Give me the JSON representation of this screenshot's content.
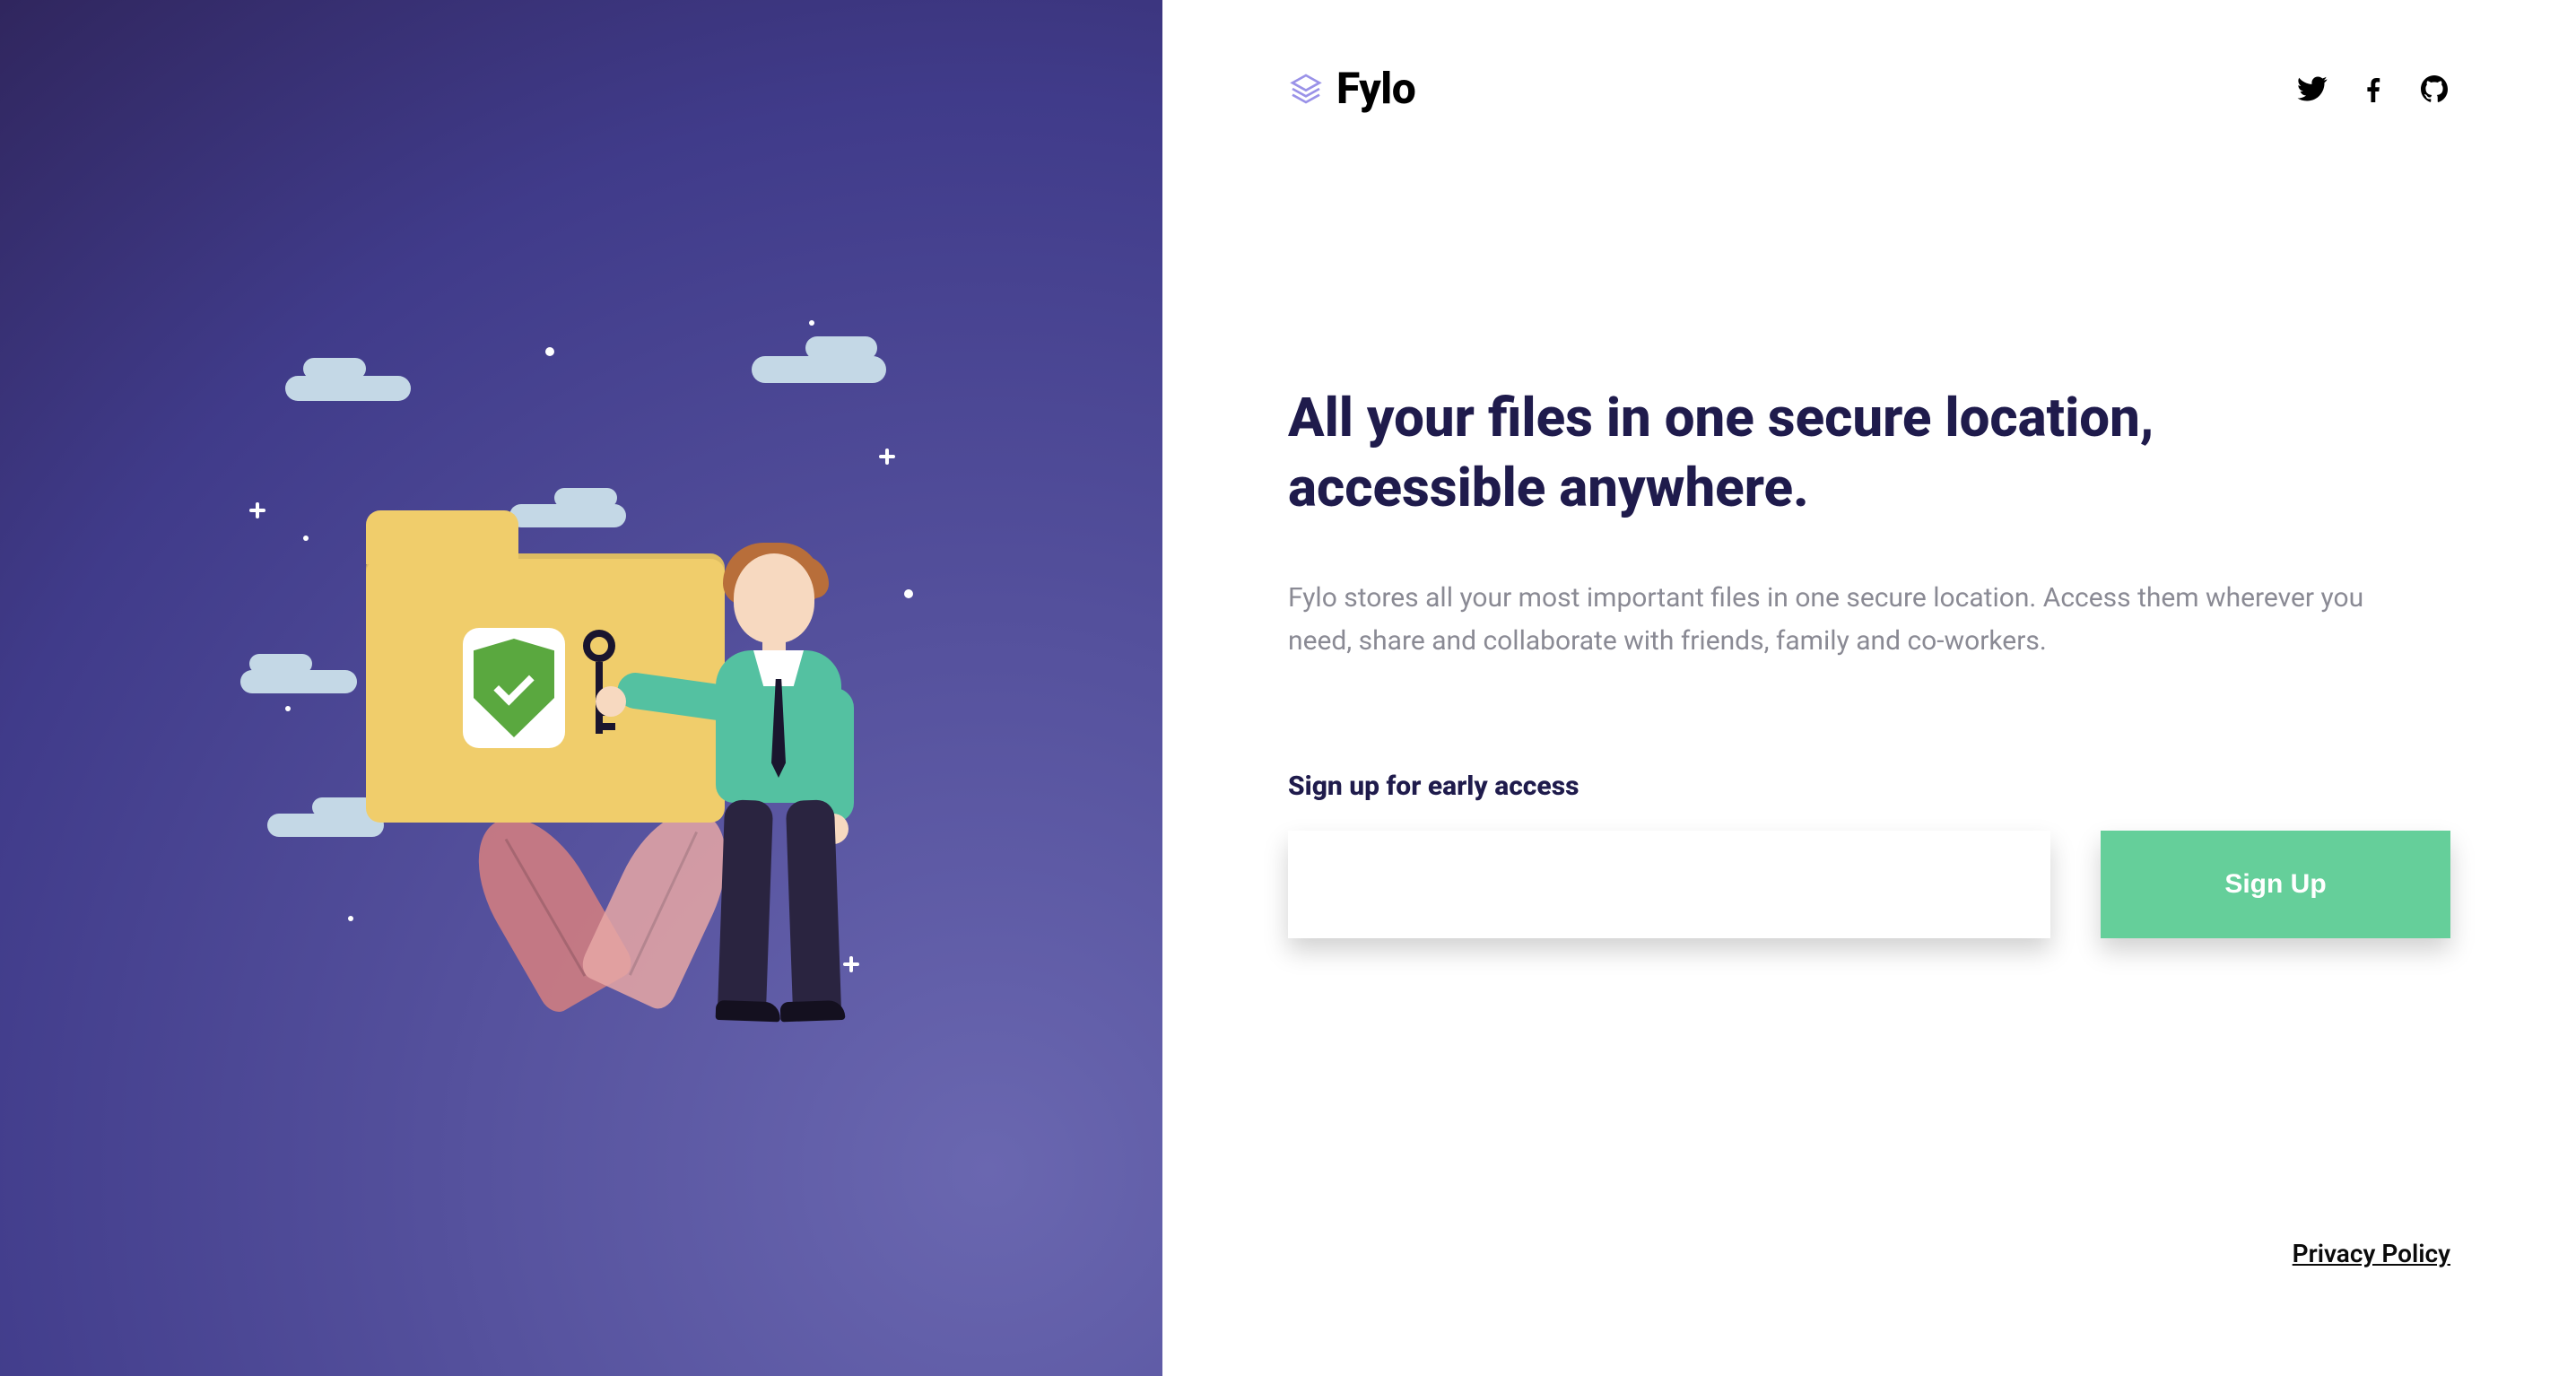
{
  "brand": {
    "name": "Fylo",
    "accent_color": "#65cf9a",
    "heading_color": "#1f1b4c",
    "logo_icon": "layers-icon"
  },
  "social": {
    "icons": [
      "twitter-icon",
      "facebook-icon",
      "github-icon"
    ]
  },
  "hero": {
    "headline": "All your files in one secure location, accessible anywhere.",
    "subtext": "Fylo stores all your most important files in one secure location. Access them wherever you need, share and collaborate with friends, family and co-workers."
  },
  "form": {
    "label": "Sign up for early access",
    "email_value": "",
    "email_placeholder": "",
    "submit_label": "Sign Up"
  },
  "footer": {
    "privacy_label": "Privacy Policy"
  },
  "illustration": {
    "description": "Person holding a key next to a locked folder with a shield checkmark, surrounded by clouds and stars on a purple gradient.",
    "icons": [
      "folder-icon",
      "shield-check-icon",
      "key-icon",
      "cloud-icon",
      "star-icon",
      "leaf-icon",
      "person-icon"
    ]
  }
}
